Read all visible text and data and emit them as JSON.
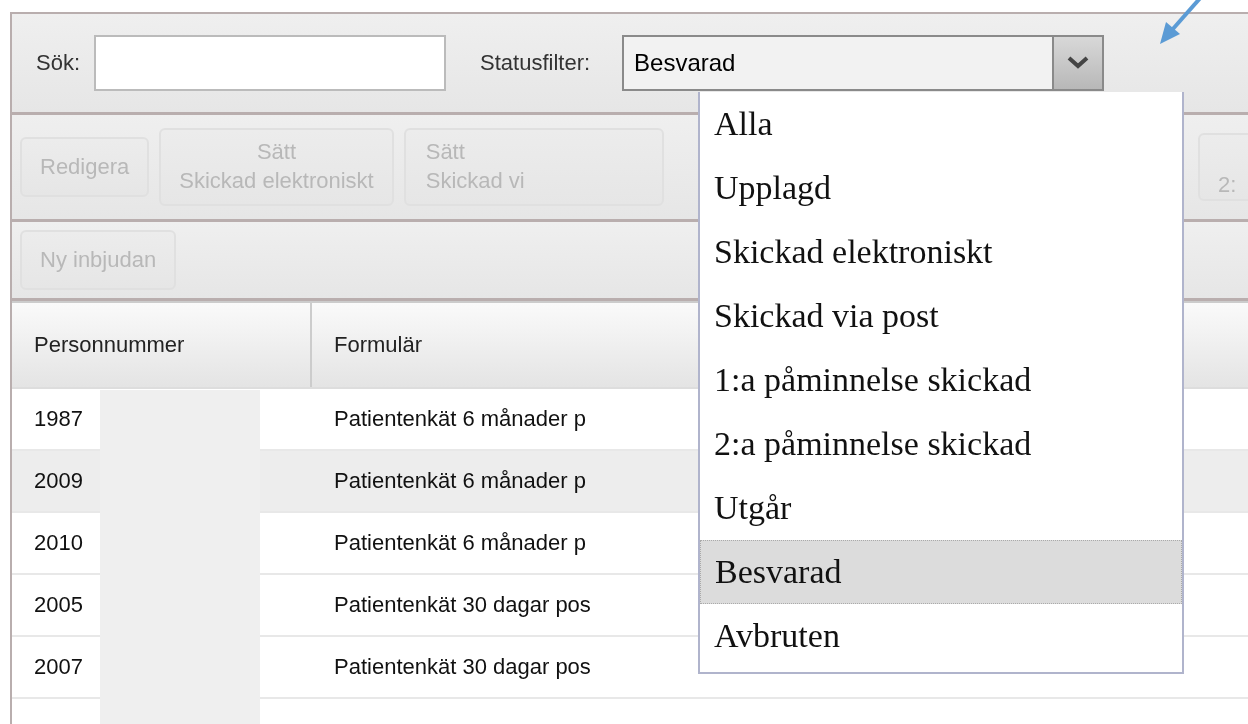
{
  "search": {
    "label": "Sök:"
  },
  "status_filter": {
    "label": "Statusfilter:",
    "value": "Besvarad",
    "expanded": true,
    "options": [
      {
        "label": "Alla",
        "selected": false
      },
      {
        "label": "Upplagd",
        "selected": false
      },
      {
        "label": "Skickad elektroniskt",
        "selected": false
      },
      {
        "label": "Skickad via post",
        "selected": false
      },
      {
        "label": "1:a påminnelse skickad",
        "selected": false
      },
      {
        "label": "2:a påminnelse skickad",
        "selected": false
      },
      {
        "label": "Utgår",
        "selected": false
      },
      {
        "label": "Besvarad",
        "selected": true
      },
      {
        "label": "Avbruten",
        "selected": false
      }
    ]
  },
  "actions": [
    {
      "lines": [
        "Redigera"
      ],
      "disabled": true
    },
    {
      "lines": [
        "Sätt",
        "Skickad elektroniskt"
      ],
      "disabled": true
    },
    {
      "lines": [
        "Sätt",
        "Skickad vi"
      ],
      "disabled": true
    },
    {
      "lines": [
        "2:"
      ],
      "disabled": true
    }
  ],
  "secondary_actions": [
    {
      "lines": [
        "Ny inbjudan"
      ],
      "disabled": true
    }
  ],
  "table": {
    "columns": [
      "Personnummer",
      "Formulär"
    ],
    "rows": [
      {
        "cells": [
          "1987",
          "Patientenkät 6 månader p"
        ],
        "hovered": false
      },
      {
        "cells": [
          "2009",
          "Patientenkät 6 månader p"
        ],
        "hovered": true
      },
      {
        "cells": [
          "2010",
          "Patientenkät 6 månader p"
        ],
        "hovered": false
      },
      {
        "cells": [
          "2005",
          "Patientenkät 30 dagar pos"
        ],
        "hovered": false
      },
      {
        "cells": [
          "2007",
          "Patientenkät 30 dagar pos"
        ],
        "hovered": false
      }
    ]
  }
}
